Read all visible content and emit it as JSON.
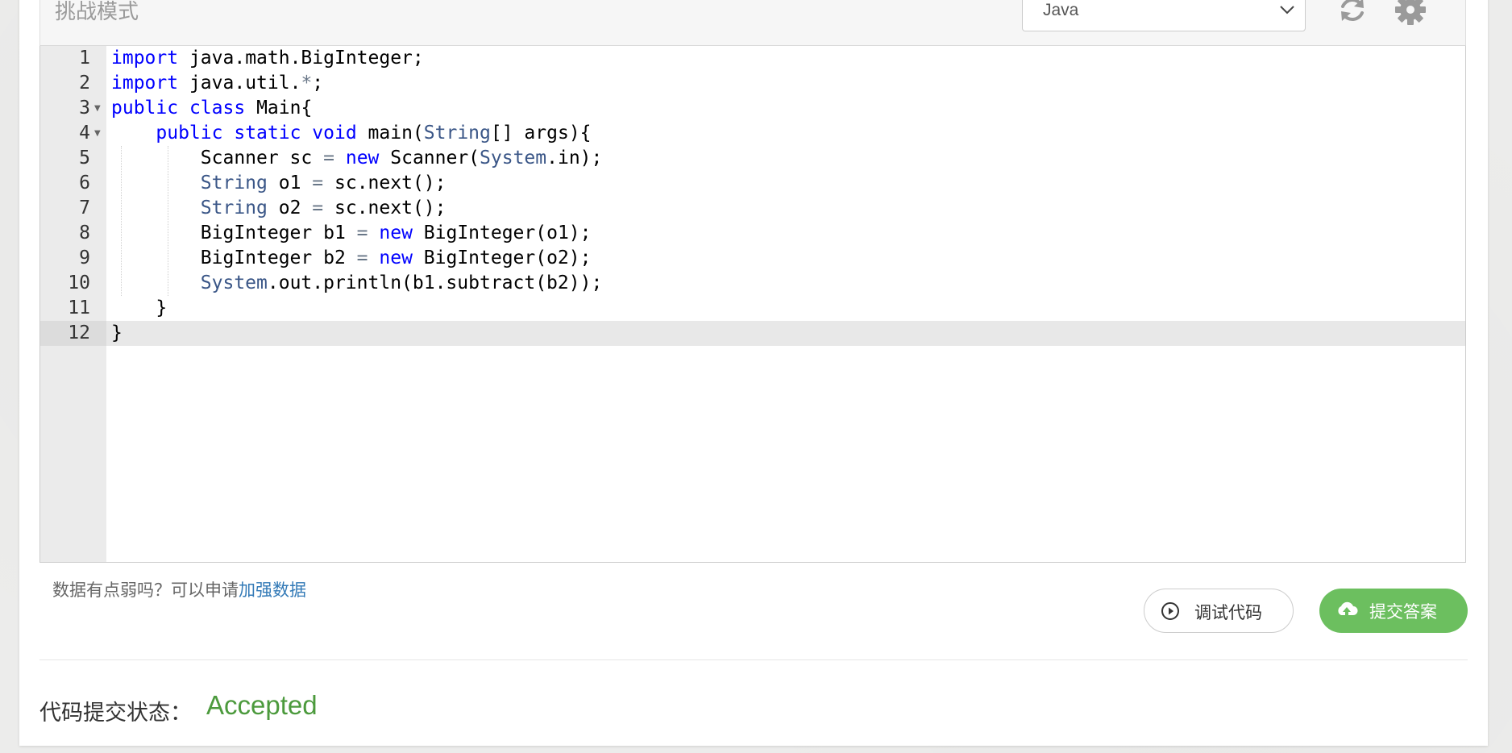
{
  "header": {
    "mode_title": "挑战模式",
    "language_selected": "Java"
  },
  "editor": {
    "lines": [
      {
        "num": "1"
      },
      {
        "num": "2"
      },
      {
        "num": "3"
      },
      {
        "num": "4"
      },
      {
        "num": "5"
      },
      {
        "num": "6"
      },
      {
        "num": "7"
      },
      {
        "num": "8"
      },
      {
        "num": "9"
      },
      {
        "num": "10"
      },
      {
        "num": "11"
      },
      {
        "num": "12"
      }
    ],
    "tokens": {
      "import": "import",
      "java_math_biginteger": "java.math.BigInteger;",
      "java_util": "java.util.",
      "star": "*",
      "semi": ";",
      "public": "public",
      "class": "class",
      "main_brace": "Main{",
      "static": "static",
      "void": "void",
      "main_open": "main(",
      "String": "String",
      "args": "[] args){",
      "Scanner": "Scanner sc",
      "eq": "=",
      "new": "new",
      "Scanner_open": "Scanner(",
      "System": "System",
      "in_close": ".in);",
      "o1": "o1",
      "o2": "o2",
      "sc_next": "sc.next();",
      "bi_b1": "BigInteger b1",
      "bi_b2": "BigInteger b2",
      "bi_o1": "BigInteger(o1);",
      "bi_o2": "BigInteger(o2);",
      "println": ".out.println(b1.subtract(b2));",
      "close_brace": "}"
    }
  },
  "footer": {
    "hint_prefix": "数据有点弱吗？可以申请",
    "hint_link": "加强数据",
    "debug_label": "调试代码",
    "submit_label": "提交答案",
    "status_label": "代码提交状态：",
    "status_value": "Accepted"
  },
  "colors": {
    "keyword": "#0000ff",
    "type": "#3a5687",
    "accepted": "#4c9a3d",
    "submit_bg": "#6cbf5f"
  }
}
